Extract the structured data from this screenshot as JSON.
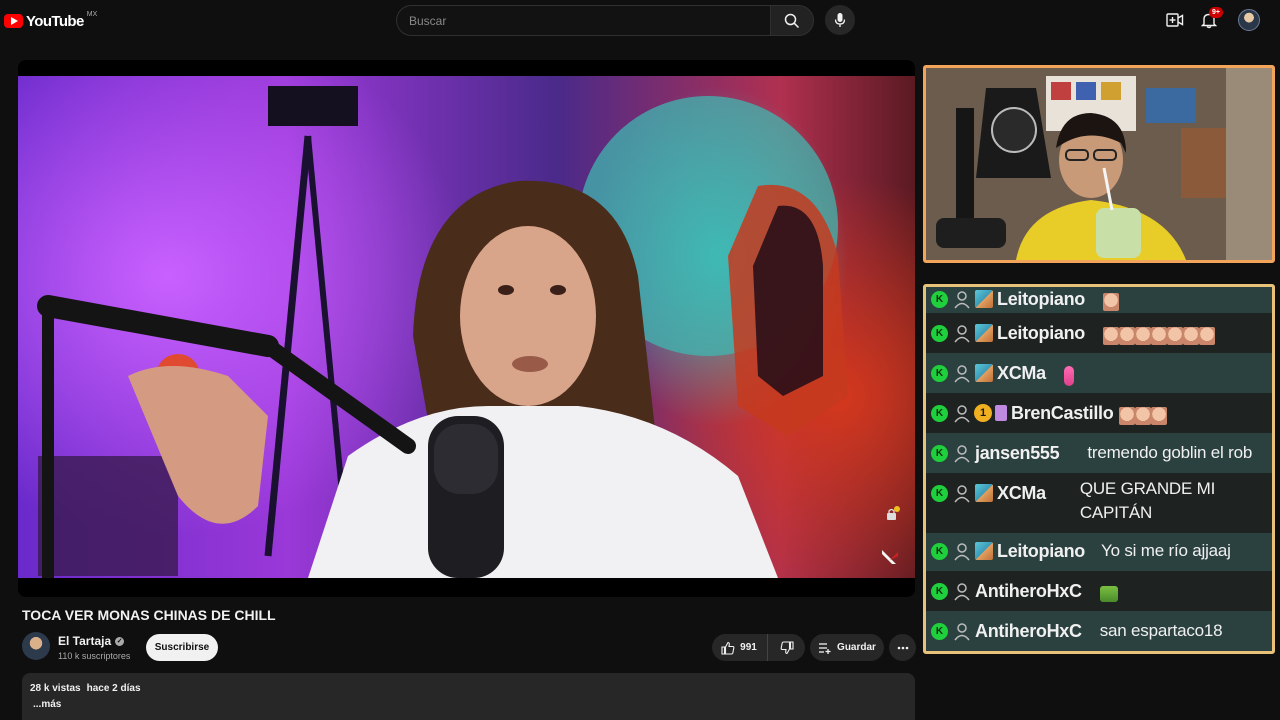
{
  "topbar": {
    "logo_text": "YouTube",
    "region": "MX",
    "search_placeholder": "Buscar",
    "notifications_count": "9+"
  },
  "video": {
    "title": "TOCA VER MONAS CHINAS DE CHILL",
    "channel_name": "El Tartaja",
    "subscribers": "110 k suscriptores",
    "subscribe_label": "Suscribirse",
    "likes": "991",
    "save_label": "Guardar",
    "views": "28 k vistas",
    "date": "hace 2 días",
    "more_label": "...más"
  },
  "chat": {
    "messages": [
      {
        "user": "Leitopiano",
        "badge": "sub",
        "text": "",
        "emotes": [
          "face"
        ]
      },
      {
        "user": "Leitopiano",
        "badge": "sub",
        "text": "",
        "emotes": [
          "face",
          "face",
          "face",
          "face",
          "face",
          "face",
          "face"
        ]
      },
      {
        "user": "XCMa",
        "badge": "sub",
        "text": "",
        "emotes": [
          "pink"
        ]
      },
      {
        "user": "BrenCastillo",
        "badge": "gift",
        "gift_count": "1",
        "text": "",
        "emotes": [
          "face",
          "face"
        ]
      },
      {
        "user": "jansen555",
        "badge": "none",
        "text": "tremendo goblin el rob",
        "emotes": []
      },
      {
        "user": "XCMa",
        "badge": "sub",
        "text": "QUE GRANDE MI CAPITÁN",
        "emotes": []
      },
      {
        "user": "Leitopiano",
        "badge": "sub",
        "text": "Yo si me río ajjaaj",
        "emotes": []
      },
      {
        "user": "AntiheroHxC",
        "badge": "none",
        "text": "",
        "emotes": [
          "green"
        ]
      },
      {
        "user": "AntiheroHxC",
        "badge": "none",
        "text": "san espartaco18",
        "emotes": []
      }
    ]
  },
  "colors": {
    "webcam_border": "#f2a55a",
    "chat_border": "#e9c27a",
    "mod_badge": "#1fcf3c",
    "chat_row_alt": "#2b4140",
    "yt_red": "#ff0000"
  },
  "icons": [
    "search-icon",
    "mic-icon",
    "create-icon",
    "bell-icon",
    "like-icon",
    "dislike-icon",
    "save-icon",
    "more-icon",
    "verified-icon",
    "user-icon"
  ]
}
